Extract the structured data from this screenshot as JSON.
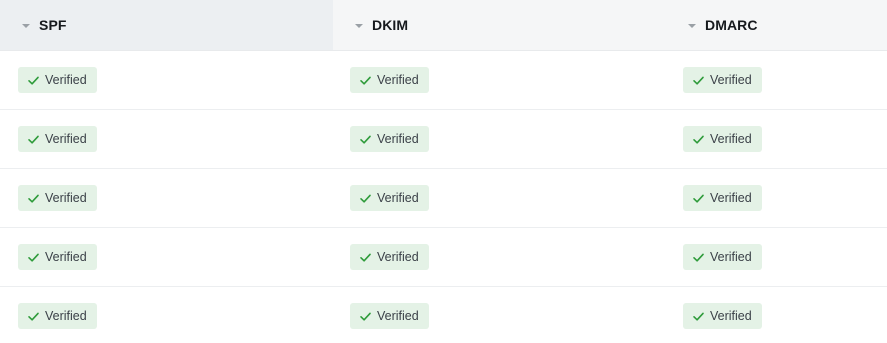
{
  "columns": [
    {
      "label": "SPF",
      "sorted": true
    },
    {
      "label": "DKIM",
      "sorted": false
    },
    {
      "label": "DMARC",
      "sorted": false
    }
  ],
  "rows": [
    [
      "Verified",
      "Verified",
      "Verified"
    ],
    [
      "Verified",
      "Verified",
      "Verified"
    ],
    [
      "Verified",
      "Verified",
      "Verified"
    ],
    [
      "Verified",
      "Verified",
      "Verified"
    ],
    [
      "Verified",
      "Verified",
      "Verified"
    ]
  ],
  "colors": {
    "badge_bg": "#e4f2e6",
    "check": "#2e9b3a",
    "header_bg": "#f5f6f7"
  },
  "icons": {
    "sort": "caret-down-icon",
    "status": "check-icon"
  }
}
